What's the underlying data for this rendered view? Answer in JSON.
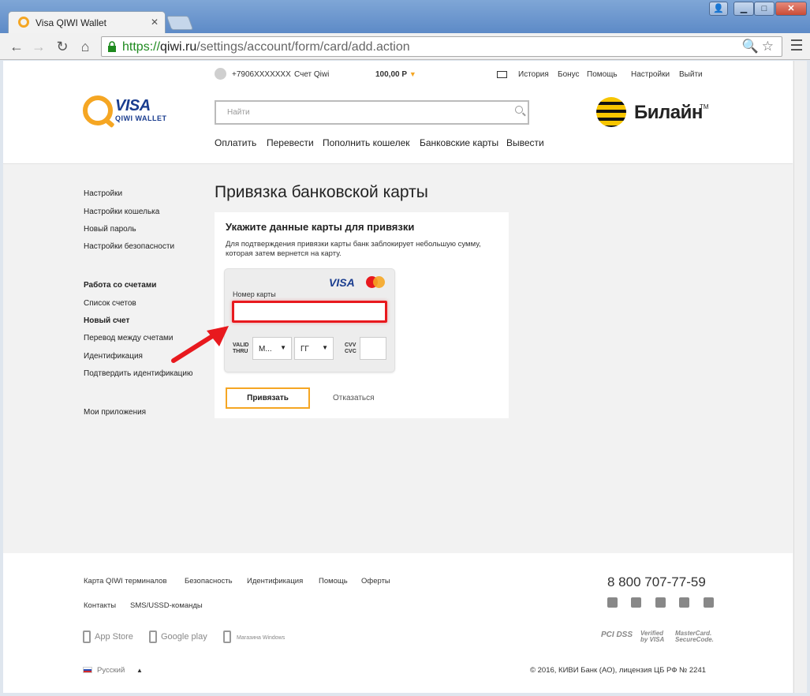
{
  "browser": {
    "tab_title": "Visa QIWI Wallet",
    "url_scheme": "https://",
    "url_host": "qiwi.ru",
    "url_path": "/settings/account/form/card/add.action"
  },
  "header": {
    "phone": "+7906XXXXXXX",
    "account": "Счет Qiwi",
    "balance": "100,00 Р",
    "top_links": [
      "История",
      "Бонус",
      "Помощь",
      "Настройки",
      "Выйти"
    ],
    "logo_visa": "VISA",
    "logo_sub": "QIWI WALLET",
    "search_placeholder": "Найти",
    "partner": "Билайн",
    "partner_tm": "TM",
    "nav": [
      "Оплатить",
      "Перевести",
      "Пополнить кошелек",
      "Банковские карты",
      "Вывести"
    ]
  },
  "sidebar": {
    "group1": [
      "Настройки",
      "Настройки кошелька",
      "Новый пароль",
      "Настройки безопасности"
    ],
    "group2_title": "Работа со счетами",
    "group2": [
      "Список счетов",
      "Новый счет",
      "Перевод между счетами",
      "Идентификация",
      "Подтвердить идентификацию"
    ],
    "apps": "Мои приложения"
  },
  "main": {
    "title": "Привязка банковской карты",
    "panel_title": "Укажите данные карты для привязки",
    "panel_desc": "Для подтверждения привязки карты банк заблокирует небольшую сумму, которая затем вернется на карту.",
    "card_brand": "VISA",
    "card_number_label": "Номер карты",
    "card_number_value": "",
    "valid_thru": "VALID THRU",
    "month_value": "М...",
    "year_value": "ГГ",
    "cvv_label": "CVV CVC",
    "bind_button": "Привязать",
    "cancel_link": "Отказаться"
  },
  "footer": {
    "links_row1": [
      "Карта QIWI терминалов",
      "Безопасность",
      "Идентификация",
      "Помощь",
      "Оферты"
    ],
    "links_row2": [
      "Контакты",
      "SMS/USSD-команды"
    ],
    "phone": "8 800 707-77-59",
    "stores": [
      "App Store",
      "Google play",
      "Магазина Windows"
    ],
    "badges": [
      "PCI DSS",
      "Verified by VISA",
      "MasterCard. SecureCode."
    ],
    "language": "Русский",
    "copyright": "© 2016, КИВИ Банк (АО), лицензия ЦБ РФ № 2241"
  },
  "colors": {
    "accent": "#f5a623",
    "visa_blue": "#1a3d8f",
    "highlight_red": "#e8191e"
  }
}
